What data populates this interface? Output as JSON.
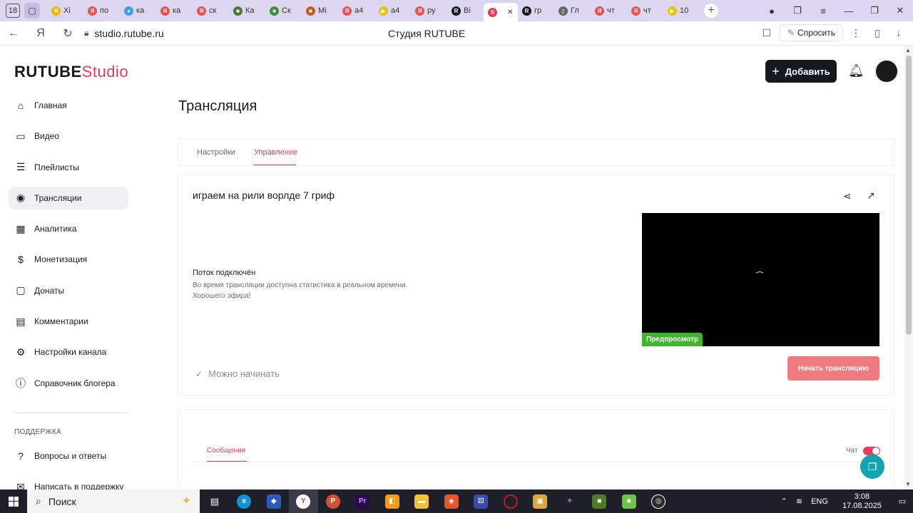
{
  "browser": {
    "tab_count": "18",
    "tabs": [
      {
        "label": "Хі",
        "fav": "Я",
        "color": "#f2b500"
      },
      {
        "label": "по",
        "fav": "Я",
        "color": "#f04d4d"
      },
      {
        "label": "ка",
        "fav": "●",
        "color": "#3aa0e0"
      },
      {
        "label": "ка",
        "fav": "Я",
        "color": "#f04d4d"
      },
      {
        "label": "ск",
        "fav": "Я",
        "color": "#f04d4d"
      },
      {
        "label": "Ка",
        "fav": "■",
        "color": "#4a7b2c"
      },
      {
        "label": "Ск",
        "fav": "■",
        "color": "#3a8d3a"
      },
      {
        "label": "Mi",
        "fav": "■",
        "color": "#c25a1c"
      },
      {
        "label": "а4",
        "fav": "Я",
        "color": "#f04d4d"
      },
      {
        "label": "а4",
        "fav": "▶",
        "color": "#e8c400"
      },
      {
        "label": "ру",
        "fav": "Я",
        "color": "#f04d4d"
      },
      {
        "label": "Ві",
        "fav": "R",
        "color": "#14191f"
      },
      {
        "label": "",
        "fav": "S",
        "color": "#ea3a57",
        "active": true
      },
      {
        "label": "гр",
        "fav": "R",
        "color": "#14191f"
      },
      {
        "label": "Гл",
        "fav": "▯",
        "color": "#666"
      },
      {
        "label": "чт",
        "fav": "Я",
        "color": "#f04d4d"
      },
      {
        "label": "чт",
        "fav": "Я",
        "color": "#f04d4d"
      },
      {
        "label": "10",
        "fav": "▶",
        "color": "#e8c400"
      }
    ],
    "url": "studio.rutube.ru",
    "page_title": "Студия RUTUBE",
    "ask_label": "Спросить"
  },
  "header": {
    "logo_main": "RUTUBE",
    "logo_sub": "Studio",
    "add_label": "Добавить"
  },
  "sidebar": {
    "items": [
      {
        "label": "Главная",
        "icon": "home-icon",
        "glyph": "⌂"
      },
      {
        "label": "Видео",
        "icon": "video-icon",
        "glyph": "▭"
      },
      {
        "label": "Плейлисты",
        "icon": "playlist-icon",
        "glyph": "☰"
      },
      {
        "label": "Трансляции",
        "icon": "broadcast-icon",
        "glyph": "◉"
      },
      {
        "label": "Аналитика",
        "icon": "analytics-icon",
        "glyph": "▦"
      },
      {
        "label": "Монетизация",
        "icon": "money-icon",
        "glyph": "$"
      },
      {
        "label": "Донаты",
        "icon": "donate-icon",
        "glyph": "▢"
      },
      {
        "label": "Комментарии",
        "icon": "comment-icon",
        "glyph": "▤"
      },
      {
        "label": "Настройки канала",
        "icon": "gear-icon",
        "glyph": "⚙"
      },
      {
        "label": "Справочник блогера",
        "icon": "info-icon",
        "glyph": "ⓘ"
      }
    ],
    "support_title": "ПОДДЕРЖКА",
    "support_items": [
      {
        "label": "Вопросы и ответы",
        "icon": "question-icon",
        "glyph": "?"
      },
      {
        "label": "Написать в поддержку",
        "icon": "mail-icon",
        "glyph": "✉"
      }
    ]
  },
  "main": {
    "title": "Трансляция",
    "tabs": [
      "Настройки",
      "Управление"
    ],
    "stream_name": "играем на рили ворлде 7 гриф",
    "status_title": "Поток подключён",
    "status_line1": "Во время трансляции доступна статистика в реальном времени.",
    "status_line2": "Хорошего эфира!",
    "preview_label": "Предпросмотр",
    "ready_label": "Можно начинать",
    "start_label": "Начать трансляцию",
    "messages_tab": "Сообщения",
    "chat_label": "Чат"
  },
  "taskbar": {
    "search_label": "Поиск",
    "lang": "ENG",
    "time": "3:08",
    "date": "17.08.2025"
  }
}
